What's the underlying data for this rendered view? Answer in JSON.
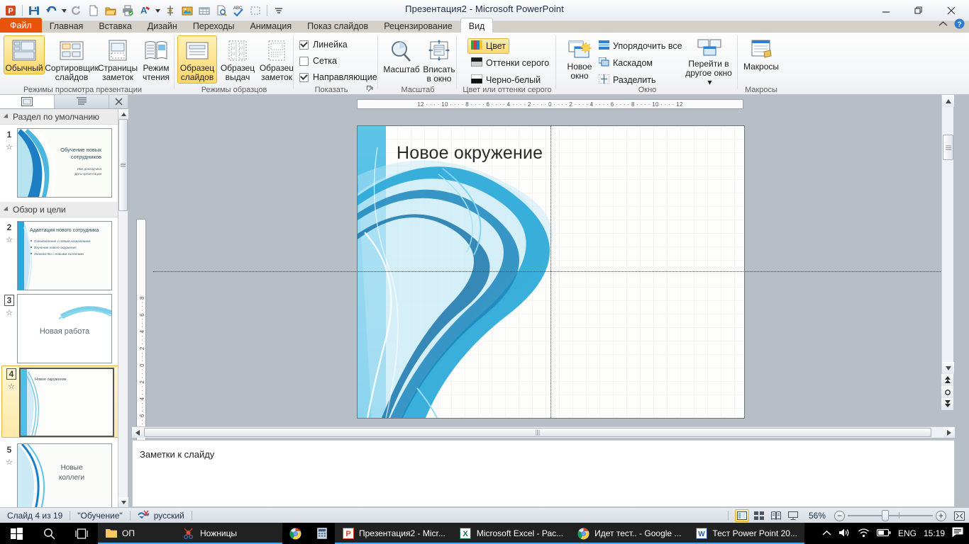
{
  "titlebar": {
    "document_title": "Презентация2  -  Microsoft PowerPoint",
    "qat": [
      {
        "name": "powerpoint-logo-icon",
        "label": "PowerPoint"
      },
      {
        "name": "save-icon",
        "label": "Сохранить"
      },
      {
        "name": "undo-icon",
        "label": "Отменить"
      },
      {
        "name": "undo-dropdown-icon",
        "label": "Отменить список"
      },
      {
        "name": "redo-icon",
        "label": "Вернуть"
      },
      {
        "name": "new-document-icon",
        "label": "Создать"
      },
      {
        "name": "open-folder-icon",
        "label": "Открыть"
      },
      {
        "name": "print-icon",
        "label": "Печать"
      },
      {
        "name": "font-color-icon",
        "label": "Цвет шрифта"
      },
      {
        "name": "font-color-dropdown-icon",
        "label": "Цвет шрифта список"
      },
      {
        "name": "format-icon",
        "label": "Формат"
      },
      {
        "name": "picture-icon",
        "label": "Рисунок"
      },
      {
        "name": "table-icon",
        "label": "Таблица"
      },
      {
        "name": "print-preview-icon",
        "label": "Предварительный просмотр"
      },
      {
        "name": "spellcheck-icon",
        "label": "Орфография"
      },
      {
        "name": "selection-icon",
        "label": "Выделение"
      },
      {
        "name": "qat-customize-icon",
        "label": "Настройка панели быстрого доступа"
      }
    ],
    "window_buttons": [
      {
        "name": "minimize-button",
        "label": "Свернуть"
      },
      {
        "name": "restore-button",
        "label": "Восстановить"
      },
      {
        "name": "close-button",
        "label": "Закрыть"
      }
    ],
    "ribbon_collapse_label": "Свернуть ленту",
    "help_label": "Справка"
  },
  "tabs": [
    {
      "id": "file",
      "label": "Файл",
      "state": "file"
    },
    {
      "id": "home",
      "label": "Главная",
      "state": "normal"
    },
    {
      "id": "insert",
      "label": "Вставка",
      "state": "normal"
    },
    {
      "id": "design",
      "label": "Дизайн",
      "state": "normal"
    },
    {
      "id": "trans",
      "label": "Переходы",
      "state": "normal"
    },
    {
      "id": "anim",
      "label": "Анимация",
      "state": "normal"
    },
    {
      "id": "show",
      "label": "Показ слайдов",
      "state": "normal"
    },
    {
      "id": "review",
      "label": "Рецензирование",
      "state": "normal"
    },
    {
      "id": "view",
      "label": "Вид",
      "state": "active"
    }
  ],
  "ribbon": {
    "groups": [
      {
        "id": "presentation-views",
        "label": "Режимы просмотра презентации"
      },
      {
        "id": "master-views",
        "label": "Режимы образцов"
      },
      {
        "id": "show",
        "label": "Показать"
      },
      {
        "id": "zoom",
        "label": "Масштаб"
      },
      {
        "id": "color-grayscale",
        "label": "Цвет или оттенки серого"
      },
      {
        "id": "window",
        "label": "Окно"
      },
      {
        "id": "macros",
        "label": "Макросы"
      }
    ],
    "presentation_views": [
      {
        "id": "normal",
        "line1": "Обычный",
        "line2": "",
        "selected": true
      },
      {
        "id": "slide-sorter",
        "line1": "Сортировщик",
        "line2": "слайдов",
        "selected": false
      },
      {
        "id": "notes-page",
        "line1": "Страницы",
        "line2": "заметок",
        "selected": false
      },
      {
        "id": "reading-view",
        "line1": "Режим",
        "line2": "чтения",
        "selected": false
      }
    ],
    "master_views": [
      {
        "id": "slide-master",
        "line1": "Образец",
        "line2": "слайдов",
        "selected": true
      },
      {
        "id": "handout-master",
        "line1": "Образец",
        "line2": "выдач",
        "selected": false
      },
      {
        "id": "notes-master",
        "line1": "Образец",
        "line2": "заметок",
        "selected": false
      }
    ],
    "show_checkboxes": [
      {
        "id": "ruler",
        "label": "Линейка",
        "checked": true
      },
      {
        "id": "gridlines",
        "label": "Сетка",
        "checked": false
      },
      {
        "id": "guides",
        "label": "Направляющие",
        "checked": true
      }
    ],
    "zoom_buttons": [
      {
        "id": "zoom",
        "line1": "Масштаб",
        "line2": ""
      },
      {
        "id": "fit-to-window",
        "line1": "Вписать",
        "line2": "в окно"
      }
    ],
    "color_buttons": [
      {
        "id": "color",
        "label": "Цвет",
        "selected": true
      },
      {
        "id": "grayscale",
        "label": "Оттенки серого",
        "selected": false
      },
      {
        "id": "black-white",
        "label": "Черно-белый",
        "selected": false
      }
    ],
    "window_big": {
      "id": "new-window",
      "line1": "Новое",
      "line2": "окно"
    },
    "window_small": [
      {
        "id": "arrange-all",
        "label": "Упорядочить все"
      },
      {
        "id": "cascade",
        "label": "Каскадом"
      },
      {
        "id": "split",
        "label": "Разделить"
      }
    ],
    "switch_windows": {
      "id": "switch-windows",
      "line1": "Перейти в",
      "line2": "другое окно"
    },
    "macros": {
      "id": "macros",
      "label": "Макросы"
    }
  },
  "slide_pane": {
    "tab_slides_label": "Слайды",
    "tab_outline_label": "Структура",
    "close_label": "Закрыть",
    "sections": [
      {
        "id": "default-section",
        "title": "Раздел по умолчанию",
        "slides": [
          {
            "number": "1",
            "title_line1": "Обучение  новых",
            "title_line2": "сотрудников",
            "sub1": "Имя докладчика",
            "sub2": "Дата презентации",
            "layout": "title",
            "selected": false
          }
        ]
      },
      {
        "id": "overview-goals",
        "title": "Обзор и цели",
        "slides": [
          {
            "number": "2",
            "title_line1": "Адаптация нового сотрудника",
            "title_line2": "",
            "bullets": [
              "Ознакомление с новым назначением",
              "Изучение нового окружения",
              "Знакомство с новыми коллегами"
            ],
            "layout": "content",
            "selected": false
          },
          {
            "number": "3",
            "title_line1": "Новая работа",
            "title_line2": "",
            "layout": "section",
            "selected": false
          },
          {
            "number": "4",
            "title_line1": "Новое окружение",
            "title_line2": "",
            "layout": "title-only",
            "selected": true
          },
          {
            "number": "5",
            "title_line1": "Новые",
            "title_line2": "коллеги",
            "layout": "section",
            "selected": false
          }
        ]
      }
    ]
  },
  "ruler": {
    "horizontal": "12 · · · · 10 · · · · 8 · · · · 6 · · · · 4 · · · · 2 · · · · 0 · · · · 2 · · · · 4 · · · · 6 · · · · 8 · · · · 10 · · · · 12",
    "vertical": "8 · · · 6 · · · 4 · · · 2 · · · 0 · · · 2 · · · 4 · · · 6 · · · 8"
  },
  "slide": {
    "title": "Новое окружение",
    "theme_accent": "#1b9ad2",
    "theme_accent_light": "#7fd3ef",
    "theme_accent_dark": "#0d7ea8"
  },
  "notes": {
    "placeholder": "Заметки к слайду"
  },
  "status": {
    "slide_counter": "Слайд 4 из 19",
    "theme_name": "\"Обучение\"",
    "language": "русский",
    "spellcheck_icon_name": "spellcheck-error-icon",
    "zoom_level": "56%",
    "view_buttons": [
      {
        "id": "normal-view",
        "name": "normal-view-button",
        "selected": true
      },
      {
        "id": "sorter-view",
        "name": "slide-sorter-view-button",
        "selected": false
      },
      {
        "id": "reading-view",
        "name": "reading-view-button",
        "selected": false
      },
      {
        "id": "slideshow-view",
        "name": "slideshow-view-button",
        "selected": false
      }
    ],
    "zoom_out_label": "−",
    "zoom_in_label": "+",
    "fit_slide_label": "Вписать слайд в текущее окно"
  },
  "taskbar": {
    "system_icons": [
      {
        "name": "windows-start-icon",
        "label": "Пуск"
      },
      {
        "name": "search-icon",
        "label": "Поиск"
      },
      {
        "name": "task-view-icon",
        "label": "Представление задач"
      }
    ],
    "items": [
      {
        "id": "op-folder",
        "label": "ОП",
        "icon": "folder-icon",
        "active": true,
        "pinned": false
      },
      {
        "id": "snipping",
        "label": "Ножницы",
        "icon": "scissors-icon",
        "active": true,
        "pinned": false
      },
      {
        "id": "chrome-pin",
        "label": "",
        "icon": "chrome-icon",
        "active": false,
        "pinned": true
      },
      {
        "id": "calc-pin",
        "label": "",
        "icon": "calculator-icon",
        "active": false,
        "pinned": true
      },
      {
        "id": "powerpoint",
        "label": "Презентация2 - Micr...",
        "icon": "powerpoint-icon",
        "active": true,
        "pinned": false
      },
      {
        "id": "excel",
        "label": "Microsoft Excel - Рас...",
        "icon": "excel-icon",
        "active": true,
        "pinned": false
      },
      {
        "id": "chrome-test",
        "label": "Идет тест.. - Google ...",
        "icon": "chrome-icon",
        "active": true,
        "pinned": false
      },
      {
        "id": "word",
        "label": "Тест  Power Point 20...",
        "icon": "word-icon",
        "active": true,
        "pinned": false
      }
    ],
    "tray": {
      "chevron_label": "Отображать скрытые значки",
      "volume_label": "Динамики",
      "network_label": "Сеть",
      "battery_label": "Батарея",
      "language": "ENG",
      "time": "15:19",
      "notifications_label": "Центр уведомлений"
    }
  }
}
